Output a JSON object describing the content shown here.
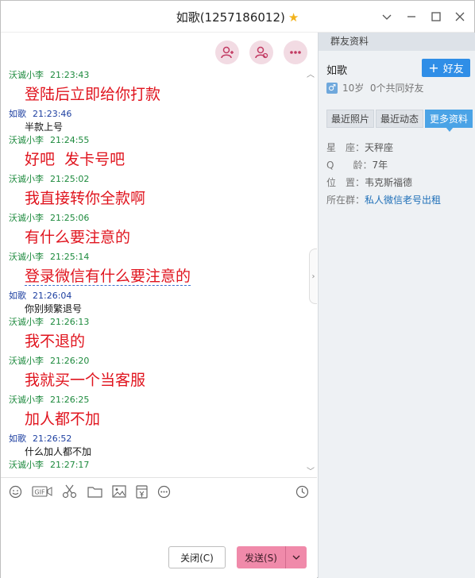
{
  "window": {
    "title": "如歌(1257186012)",
    "star_icon": "star-icon"
  },
  "chat_actions": [
    {
      "name": "invite-member-icon"
    },
    {
      "name": "create-group-icon"
    },
    {
      "name": "more-icon"
    }
  ],
  "messages": [
    {
      "sender": "沃诚小李",
      "time": "21:23:43",
      "text": "登陆后立即给你打款",
      "style": "big",
      "color": "green"
    },
    {
      "sender": "如歌",
      "time": "21:23:46",
      "text": "半款上号",
      "style": "small",
      "color": "blue"
    },
    {
      "sender": "沃诚小李",
      "time": "21:24:55",
      "text": "好吧  发卡号吧",
      "style": "big",
      "color": "green"
    },
    {
      "sender": "沃诚小李",
      "time": "21:25:02",
      "text": "我直接转你全款啊",
      "style": "big",
      "color": "green"
    },
    {
      "sender": "沃诚小李",
      "time": "21:25:06",
      "text": "有什么要注意的",
      "style": "big",
      "color": "green"
    },
    {
      "sender": "沃诚小李",
      "time": "21:25:14",
      "text": "登录微信有什么要注意的",
      "style": "big",
      "color": "green"
    },
    {
      "sender": "如歌",
      "time": "21:26:04",
      "text": "你别频繁退号",
      "style": "small",
      "color": "blue"
    },
    {
      "sender": "沃诚小李",
      "time": "21:26:13",
      "text": "我不退的",
      "style": "big",
      "color": "green"
    },
    {
      "sender": "沃诚小李",
      "time": "21:26:20",
      "text": "我就买一个当客服",
      "style": "big",
      "color": "green"
    },
    {
      "sender": "沃诚小李",
      "time": "21:26:25",
      "text": "加人都不加",
      "style": "big",
      "color": "green"
    },
    {
      "sender": "如歌",
      "time": "21:26:52",
      "text": "什么加人都不加",
      "style": "small",
      "color": "blue"
    },
    {
      "sender": "沃诚小李",
      "time": "21:27:17",
      "text": "",
      "style": "none",
      "color": "green"
    }
  ],
  "toolbar": {
    "gif_label": "GIF",
    "icons": [
      "emoji-icon",
      "gif-icon",
      "screenshot-icon",
      "folder-icon",
      "image-icon",
      "red-packet-icon",
      "more-tools-icon",
      "history-icon"
    ]
  },
  "buttons": {
    "close_label": "关闭(C)",
    "send_label": "发送(S)"
  },
  "panel": {
    "header": "群友资料",
    "name": "如歌",
    "add_friend": "好友",
    "info": "10岁  0个共同好友",
    "tabs": [
      "最近照片",
      "最近动态",
      "更多资料"
    ],
    "active_tab": "更多资料",
    "rows": [
      {
        "label": "星　座：",
        "value": "天秤座"
      },
      {
        "label": "Q　　龄：",
        "value": "7年"
      },
      {
        "label": "位　置：",
        "value": "韦克斯福德"
      },
      {
        "label": "所在群：",
        "value": "私人微信老号出租"
      }
    ]
  },
  "colors": {
    "accent_pink": "#f08aaa",
    "button_blue": "#2f8ee7",
    "message_red": "#e0141e",
    "sender_green": "#1d8a3d",
    "sender_blue": "#1d3fa0"
  }
}
